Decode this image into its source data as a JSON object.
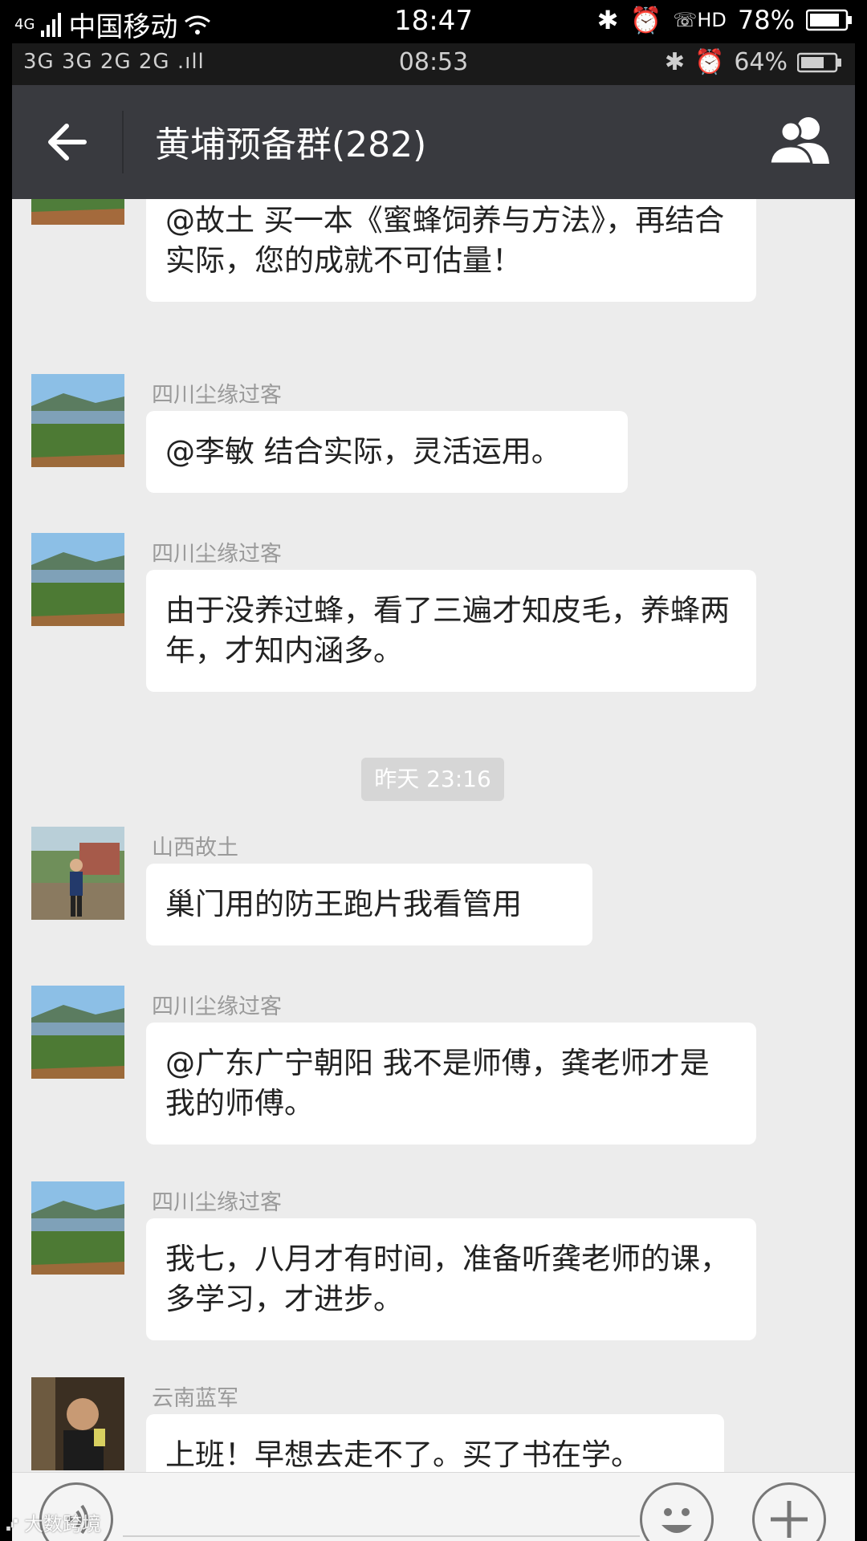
{
  "outer_status": {
    "carrier": "中国移动",
    "network": "4G",
    "time": "18:47",
    "battery": "78%"
  },
  "inner_status": {
    "network": "3G 3G 2G 2G",
    "time": "08:53",
    "battery": "64%"
  },
  "header": {
    "title": "黄埔预备群(282)"
  },
  "messages": [
    {
      "name": "",
      "text": "@故土 买一本《蜜蜂饲养与方法》，再结合实际，您的成就不可估量！"
    },
    {
      "name": "四川尘缘过客",
      "text": "@李敏 结合实际，灵活运用。"
    },
    {
      "name": "四川尘缘过客",
      "text": "由于没养过蜂，看了三遍才知皮毛，养蜂两年，才知内涵多。"
    },
    {
      "name": "山西故土",
      "text": "巢门用的防王跑片我看管用"
    },
    {
      "name": "四川尘缘过客",
      "text": "@广东广宁朝阳 我不是师傅，龚老师才是我的师傅。"
    },
    {
      "name": "四川尘缘过客",
      "text": "我七，八月才有时间，准备听龚老师的课，多学习，才进步。"
    },
    {
      "name": "云南蓝军",
      "text": "上班！早想去走不了。买了书在学。"
    }
  ],
  "timestamp": "昨天 23:16",
  "watermark": "大数跨境",
  "colors": {
    "titlebar": "#393a3f",
    "chat_bg": "#ececec",
    "bubble": "#ffffff"
  }
}
